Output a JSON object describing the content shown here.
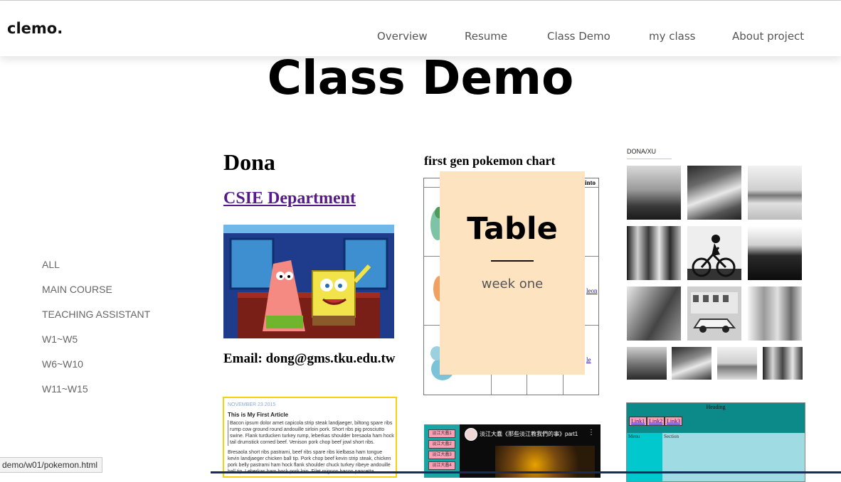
{
  "header": {
    "logo": "clemo.",
    "nav": [
      "Overview",
      "Resume",
      "Class Demo",
      "my class",
      "About project"
    ]
  },
  "page_title": "Class Demo",
  "filters": [
    "ALL",
    "MAIN COURSE",
    "TEACHING ASSISTANT",
    "W1~W5",
    "W6~W10",
    "W11~W15"
  ],
  "profile_card": {
    "name": "Dona",
    "department_link": "CSIE Department",
    "email": "Email: dong@gms.tku.edu.tw"
  },
  "article_card": {
    "date": "NOVEMBER 23 2015",
    "title": "This is My First Article",
    "paragraph1": "Bacon ipsum dolor amet capicola strip steak landjaeger, biltong spare ribs rump cow ground round andouille sirloin pork. Short ribs pig prosciutto swine. Flank turducken turkey rump, leberkas shoulder bresaola ham hock tail drumstick corned beef. Venison pork chop beef jowl short ribs.",
    "paragraph2": "Bresaola short ribs pastrami, beef ribs spare ribs kielbasa ham tongue kevin landjaeger chicken ball tip. Pork chop beef kevin strip steak, chicken pork belly pastrami ham hock flank shoulder chuck turkey ribeye andouille ball tip. Leberkas ham hock pork loin. Filet mignon bacon pancetta."
  },
  "pokemon_card": {
    "title": "first gen pokemon chart",
    "header_cell": "into",
    "link_1": "leon",
    "link_2": "le"
  },
  "hover_overlay": {
    "title": "Table",
    "subtitle": "week one"
  },
  "video_card": {
    "title": "淡江大蠢《那些淡江教我們的事》part1",
    "side_buttons": [
      "淡江大蠢1",
      "淡江大蠢2",
      "淡江大蠢3",
      "淡江大蠢4"
    ]
  },
  "gallery_card": {
    "label": "DONA/XU"
  },
  "layout_card": {
    "heading": "Heading",
    "links": [
      "Link1",
      "Link2",
      "Link3"
    ],
    "menu": "Menu",
    "section": "Section"
  },
  "status_bar": {
    "url": "demo/w01/pokemon.html"
  },
  "colors": {
    "overlay_bg": "#fee3c1",
    "article_border": "#f5d20b",
    "link_visited": "#551a8b",
    "layout_header": "#0c8a8a",
    "layout_menu": "#00c8cc",
    "layout_section": "#9fdbe3",
    "video_sidebar": "#1aa5a2"
  }
}
